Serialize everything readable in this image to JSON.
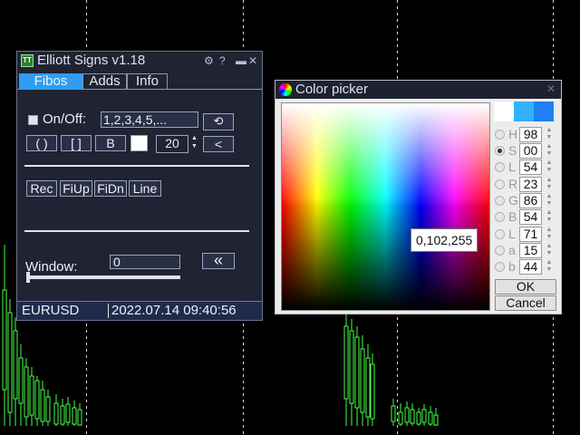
{
  "elliott_panel": {
    "title": "Elliott Signs v1.18",
    "logo_text": "TT",
    "tabs": [
      {
        "label": "Fibos",
        "active": true
      },
      {
        "label": "Adds",
        "active": false
      },
      {
        "label": "Info",
        "active": false
      }
    ],
    "onoff_label": "On/Off:",
    "wave_labels": "1,2,3,4,5,...",
    "paren_button": "( )",
    "bracket_button": "[ ]",
    "b_button": "B",
    "size_value": "20",
    "less_button": "<",
    "rec_button": "Rec",
    "fiup_button": "FiUp",
    "fidn_button": "FiDn",
    "line_button": "Line",
    "window_label": "Window:",
    "window_value": "0",
    "collapse_button": "«",
    "symbol": "EURUSD",
    "datetime": "2022.07.14 09:40:56",
    "slider_position": 0
  },
  "color_picker": {
    "title": "Color picker",
    "tooltip": "0,102,255",
    "swatches": [
      "#ffffff",
      "#33b1ff",
      "#1f7ff5"
    ],
    "channels": [
      {
        "letter": "H",
        "value": "98",
        "selected": false
      },
      {
        "letter": "S",
        "value": "00",
        "selected": true
      },
      {
        "letter": "L",
        "value": "54",
        "selected": false
      },
      {
        "letter": "R",
        "value": "23",
        "selected": false
      },
      {
        "letter": "G",
        "value": "86",
        "selected": false
      },
      {
        "letter": "B",
        "value": "54",
        "selected": false
      },
      {
        "letter": "L",
        "value": "71",
        "selected": false
      },
      {
        "letter": "a",
        "value": "15",
        "selected": false
      },
      {
        "letter": "b",
        "value": "44",
        "selected": false
      }
    ],
    "ok_label": "OK",
    "cancel_label": "Cancel"
  },
  "colors": {
    "panel_bg": "#1f2332",
    "active_tab": "#2f9df2",
    "candle_green": "#44ff44",
    "grid": "#ffffff"
  }
}
